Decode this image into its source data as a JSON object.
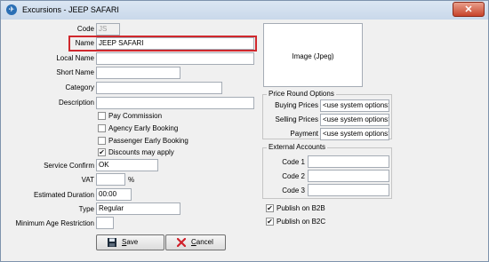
{
  "window": {
    "title": "Excursions - JEEP SAFARI",
    "close_symbol": "✕"
  },
  "form": {
    "code": {
      "label": "Code",
      "value": "JS"
    },
    "name": {
      "label": "Name",
      "value": "JEEP SAFARI"
    },
    "local_name": {
      "label": "Local Name",
      "value": ""
    },
    "short_name": {
      "label": "Short Name",
      "value": ""
    },
    "category": {
      "label": "Category",
      "value": ""
    },
    "description": {
      "label": "Description",
      "value": ""
    },
    "pay_commission": {
      "label": "Pay Commission",
      "checked": false
    },
    "agency_early": {
      "label": "Agency Early Booking",
      "checked": false
    },
    "passenger_early": {
      "label": "Passenger Early Booking",
      "checked": false
    },
    "discounts": {
      "label": "Discounts may apply",
      "checked": true
    },
    "service_confirm": {
      "label": "Service Confirm",
      "value": "OK"
    },
    "vat": {
      "label": "VAT",
      "value": "",
      "unit": "%"
    },
    "duration": {
      "label": "Estimated Duration",
      "value": "00:00"
    },
    "type": {
      "label": "Type",
      "value": "Regular"
    },
    "min_age": {
      "label": "Minimum Age Restriction",
      "value": ""
    }
  },
  "image": {
    "label": "Image  (Jpeg)"
  },
  "price_round": {
    "title": "Price Round Options",
    "buying": {
      "label": "Buying Prices",
      "value": "<use system options>"
    },
    "selling": {
      "label": "Selling Prices",
      "value": "<use system options>"
    },
    "payment": {
      "label": "Payment",
      "value": "<use system options>"
    }
  },
  "external_accounts": {
    "title": "External Accounts",
    "code1": {
      "label": "Code 1",
      "value": ""
    },
    "code2": {
      "label": "Code 2",
      "value": ""
    },
    "code3": {
      "label": "Code 3",
      "value": ""
    }
  },
  "publish": {
    "b2b": {
      "label": "Publish on B2B",
      "checked": true
    },
    "b2c": {
      "label": "Publish on B2C",
      "checked": true
    }
  },
  "buttons": {
    "save_hotkey": "S",
    "save_rest": "ave",
    "cancel_hotkey": "C",
    "cancel_rest": "ancel"
  },
  "colors": {
    "highlight": "#d0282d",
    "checkmark": "#222222"
  },
  "icons": {
    "save": "floppy-disk-icon",
    "cancel": "red-x-icon"
  }
}
